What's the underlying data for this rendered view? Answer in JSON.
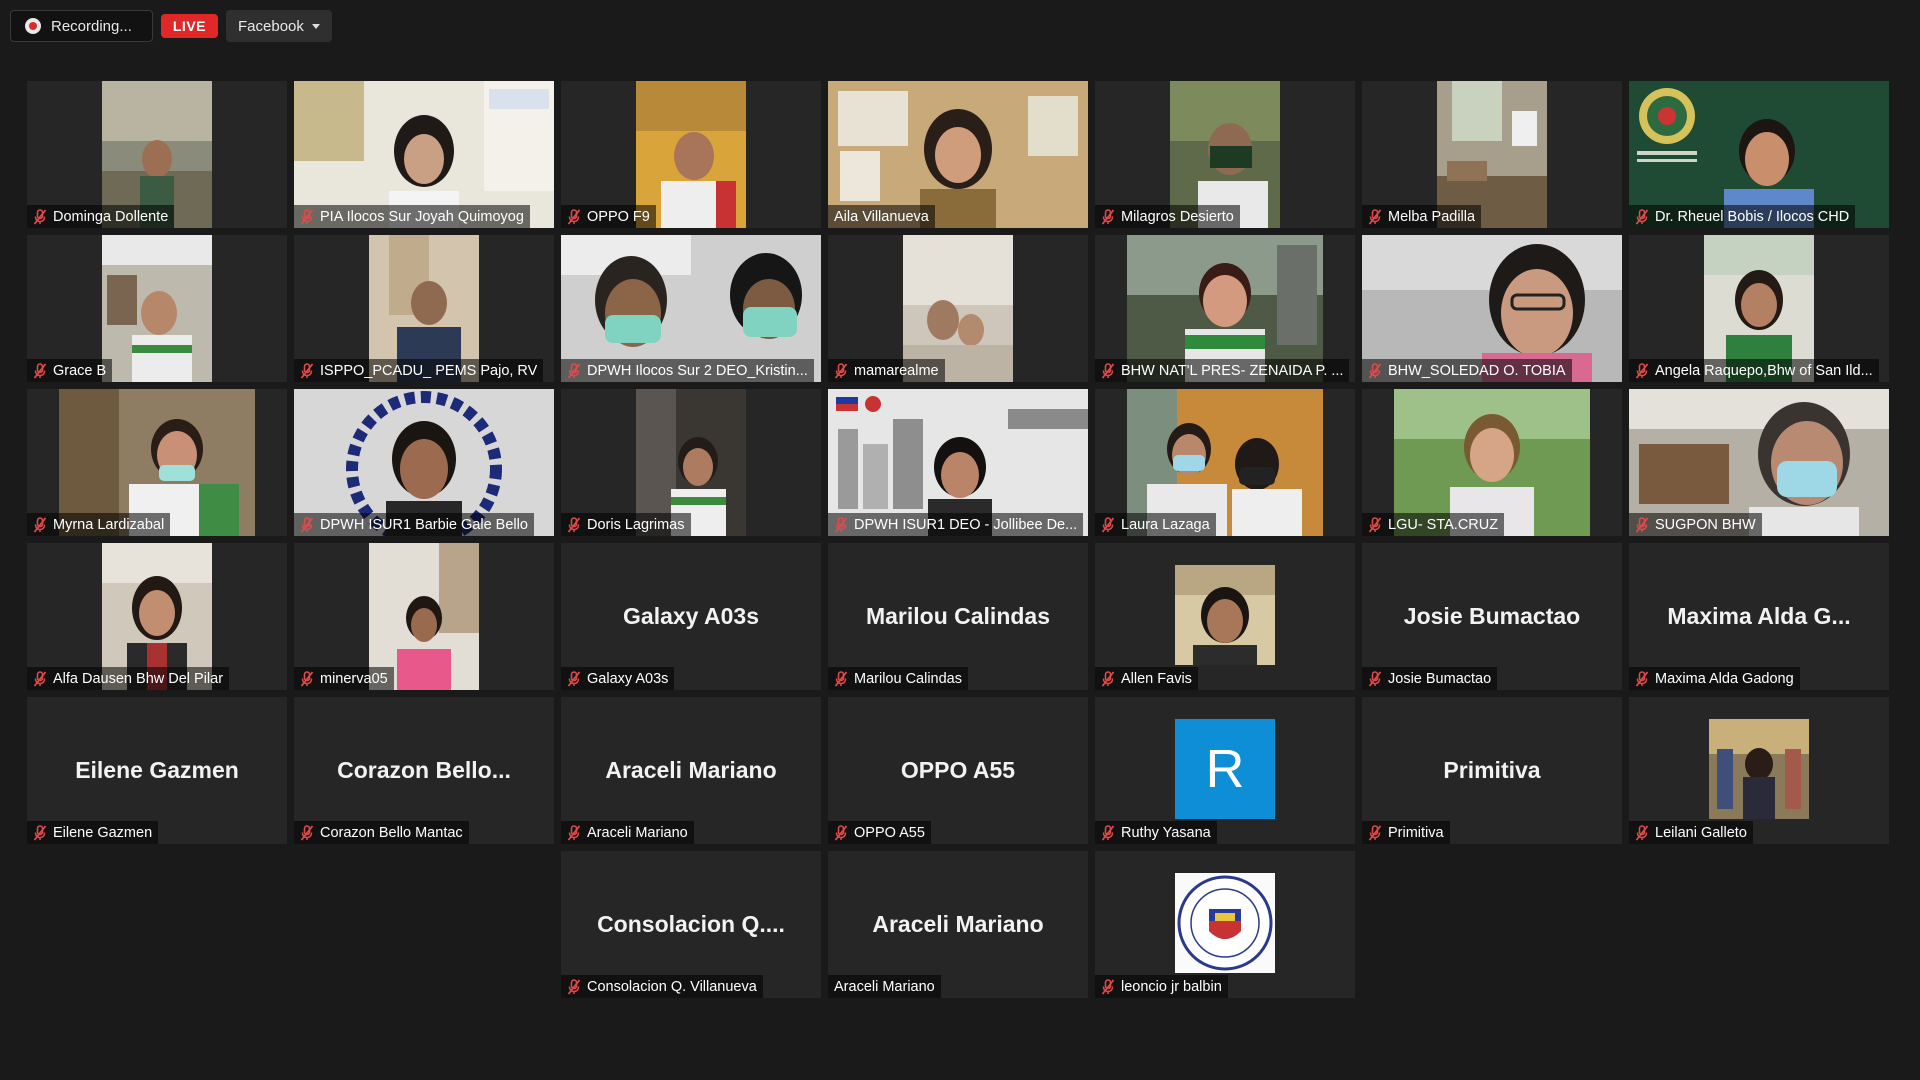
{
  "topbar": {
    "recording_label": "Recording...",
    "live_label": "LIVE",
    "stream_target": "Facebook"
  },
  "colors": {
    "background": "#1a1a1a",
    "tile": "#262626",
    "active_speaker_border": "#e3ee7d",
    "live_badge": "#e02828",
    "muted_icon": "#e24a4a"
  },
  "participants": [
    {
      "name": "Dominga Dollente",
      "muted": true
    },
    {
      "name": "PIA Ilocos Sur Joyah Quimoyog",
      "muted": true
    },
    {
      "name": "OPPO F9",
      "muted": true
    },
    {
      "name": "Aila Villanueva",
      "muted": false,
      "active_speaker": true
    },
    {
      "name": "Milagros Desierto",
      "muted": true
    },
    {
      "name": "Melba Padilla",
      "muted": true
    },
    {
      "name": "Dr. Rheuel Bobis / Ilocos CHD",
      "muted": true
    },
    {
      "name": "Grace B",
      "muted": true
    },
    {
      "name": "ISPPO_PCADU_ PEMS  Pajo, RV",
      "muted": true
    },
    {
      "name": "DPWH Ilocos Sur 2 DEO_Kristin...",
      "muted": true
    },
    {
      "name": "mamarealme",
      "muted": true
    },
    {
      "name": "BHW NAT'L PRES- ZENAIDA P. ...",
      "muted": true
    },
    {
      "name": "BHW_SOLEDAD O. TOBIA",
      "muted": true
    },
    {
      "name": "Angela Raquepo,Bhw of San Ild...",
      "muted": true
    },
    {
      "name": "Myrna Lardizabal",
      "muted": true
    },
    {
      "name": "DPWH ISUR1 Barbie Gale Bello",
      "muted": true
    },
    {
      "name": "Doris Lagrimas",
      "muted": true
    },
    {
      "name": "DPWH ISUR1 DEO - Jollibee De...",
      "muted": true
    },
    {
      "name": "Laura Lazaga",
      "muted": true
    },
    {
      "name": "LGU- STA.CRUZ",
      "muted": true
    },
    {
      "name": "SUGPON BHW",
      "muted": true
    },
    {
      "name": "Alfa Dausen Bhw Del Pilar",
      "muted": true
    },
    {
      "name": "minerva05",
      "muted": true
    },
    {
      "name": "Galaxy A03s",
      "muted": true,
      "display_name": "Galaxy A03s"
    },
    {
      "name": "Marilou Calindas",
      "muted": true,
      "display_name": "Marilou Calindas"
    },
    {
      "name": "Allen Favis",
      "muted": true
    },
    {
      "name": "Josie Bumactao",
      "muted": true,
      "display_name": "Josie Bumactao"
    },
    {
      "name": "Maxima Alda Gadong",
      "muted": true,
      "display_name": "Maxima  Alda  G..."
    },
    {
      "name": "Eilene Gazmen",
      "muted": true,
      "display_name": "Eilene Gazmen"
    },
    {
      "name": "Corazon Bello Mantac",
      "muted": true,
      "display_name": "Corazon  Bello..."
    },
    {
      "name": "Araceli Mariano",
      "muted": true,
      "display_name": "Araceli Mariano"
    },
    {
      "name": "OPPO A55",
      "muted": true,
      "display_name": "OPPO A55"
    },
    {
      "name": "Ruthy Yasana",
      "muted": true,
      "avatar_letter": "R"
    },
    {
      "name": "Primitiva",
      "muted": true,
      "display_name": "Primitiva"
    },
    {
      "name": "Leilani Galleto",
      "muted": true
    },
    {
      "name": "Consolacion Q. Villanueva",
      "muted": true,
      "display_name": "Consolacion  Q...."
    },
    {
      "name": "Araceli Mariano",
      "muted": false,
      "display_name": "Araceli Mariano"
    },
    {
      "name": "leoncio jr balbin",
      "muted": true
    }
  ]
}
